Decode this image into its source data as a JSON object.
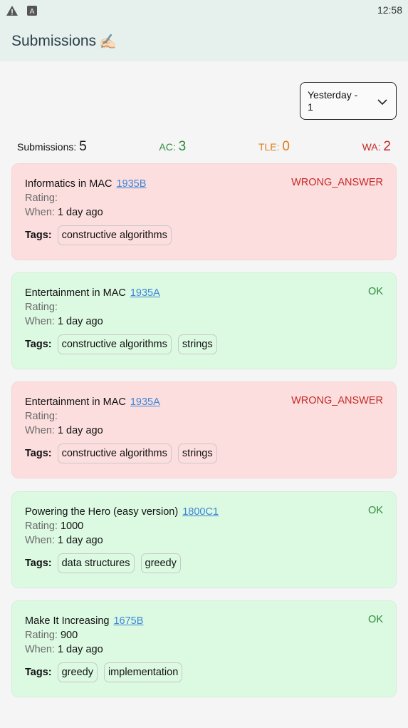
{
  "status_bar": {
    "time": "12:58"
  },
  "app_bar": {
    "title": "Submissions",
    "emoji": "✍🏻"
  },
  "filter": {
    "line1": "Yesterday -",
    "line2": "1"
  },
  "summary": {
    "submissions_label": "Submissions:",
    "submissions_value": "5",
    "ac_label": "AC:",
    "ac_value": "3",
    "tle_label": "TLE:",
    "tle_value": "0",
    "wa_label": "WA:",
    "wa_value": "2"
  },
  "labels": {
    "rating": "Rating:",
    "when": "When:",
    "tags": "Tags:"
  },
  "submissions": [
    {
      "name": "Informatics in MAC",
      "id": "1935B",
      "verdict": "WRONG_ANSWER",
      "rating": "",
      "when": "1 day ago",
      "tags": [
        "constructive algorithms"
      ]
    },
    {
      "name": "Entertainment in MAC",
      "id": "1935A",
      "verdict": "OK",
      "rating": "",
      "when": "1 day ago",
      "tags": [
        "constructive algorithms",
        "strings"
      ]
    },
    {
      "name": "Entertainment in MAC",
      "id": "1935A",
      "verdict": "WRONG_ANSWER",
      "rating": "",
      "when": "1 day ago",
      "tags": [
        "constructive algorithms",
        "strings"
      ]
    },
    {
      "name": "Powering the Hero (easy version)",
      "id": "1800C1",
      "verdict": "OK",
      "rating": "1000",
      "when": "1 day ago",
      "tags": [
        "data structures",
        "greedy"
      ]
    },
    {
      "name": "Make It Increasing",
      "id": "1675B",
      "verdict": "OK",
      "rating": "900",
      "when": "1 day ago",
      "tags": [
        "greedy",
        "implementation"
      ]
    }
  ],
  "colors": {
    "wrong_bg": "#fddede",
    "ok_bg": "#dcf9e2",
    "ac": "#2e8b3a",
    "tle": "#e07b20",
    "wa": "#c62828",
    "link": "#3d86d6"
  }
}
